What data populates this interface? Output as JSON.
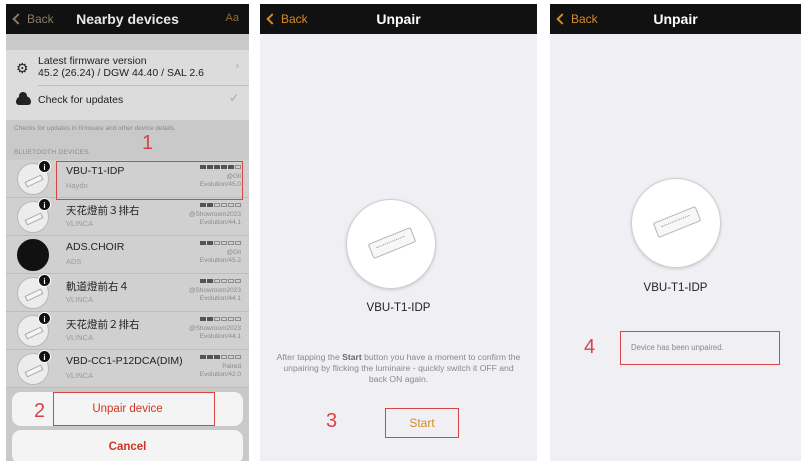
{
  "panel1": {
    "nav": {
      "back_label": "Back",
      "title": "Nearby devices",
      "aa_label": "Aa"
    },
    "firmware": {
      "title": "Latest firmware version",
      "version": "45.2 (26.24) / DGW 44.40 / SAL 2.6",
      "icon": "gear-icon",
      "chevron": "›",
      "check_label": "Check for updates",
      "check_mark": "✓"
    },
    "hint": "Checks for updates in firmware and other device details.",
    "section_label": "BLUETOOTH DEVICES",
    "devices": [
      {
        "name": "VBU-T1-IDP",
        "sub": "Haydn",
        "meta1": "@Gll",
        "meta2": "Evolution/45.0",
        "signal": 5
      },
      {
        "name": "天花燈前３排右",
        "sub": "VLINCA",
        "meta1": "@Showroom2023",
        "meta2": "Evolution/44.1",
        "signal": 2
      },
      {
        "name": "ADS.CHOIR",
        "sub": "ADS",
        "meta1": "@Gll",
        "meta2": "Evolution/45.2",
        "signal": 2
      },
      {
        "name": "軌道燈前右４",
        "sub": "VLINCA",
        "meta1": "@Showroom2023",
        "meta2": "Evolution/44.1",
        "signal": 2
      },
      {
        "name": "天花燈前２排右",
        "sub": "VLINCA",
        "meta1": "@Showroom2023",
        "meta2": "Evolution/44.1",
        "signal": 2
      },
      {
        "name": "VBD-CC1-P12DCA(DIM)",
        "sub": "VLINCA",
        "meta1": "Paired",
        "meta2": "Evolution/42.0",
        "signal": 3
      }
    ],
    "info_badge": "i",
    "unpair_label": "Unpair device",
    "cancel_label": "Cancel"
  },
  "panel2": {
    "nav": {
      "back_label": "Back",
      "title": "Unpair"
    },
    "device_name": "VBU-T1-IDP",
    "instruction_pre": "After tapping the ",
    "instruction_bold": "Start",
    "instruction_post": " button you have a moment to confirm the unpairing by flicking the luminaire - quickly switch it OFF and back ON again.",
    "start_label": "Start"
  },
  "panel3": {
    "nav": {
      "back_label": "Back",
      "title": "Unpair"
    },
    "device_name": "VBU-T1-IDP",
    "message": "Device has been unpaired."
  },
  "steps": [
    "1",
    "2",
    "3",
    "4"
  ],
  "colors": {
    "accent": "#d98a28",
    "highlight": "#d64545",
    "destructive": "#d0341f",
    "navbar": "#111111"
  }
}
